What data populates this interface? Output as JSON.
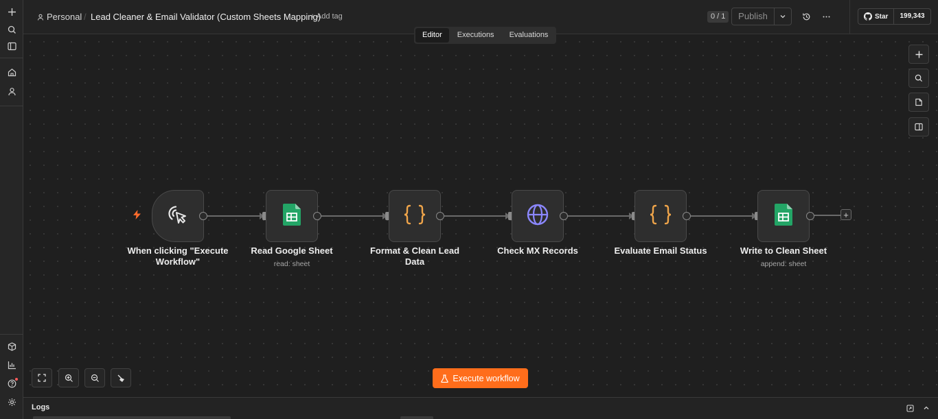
{
  "header": {
    "project": "Personal",
    "title": "Lead Cleaner & Email Validator (Custom Sheets Mapping)",
    "add_tag": "+ Add tag",
    "version_count": "0 / 1",
    "publish_label": "Publish",
    "github_star": "Star",
    "github_count": "199,343"
  },
  "tabs": [
    "Editor",
    "Executions",
    "Evaluations"
  ],
  "active_tab": "Editor",
  "nodes": [
    {
      "label": "When clicking \"Execute Workflow\"",
      "subtitle": "",
      "icon": "cursor-click-icon"
    },
    {
      "label": "Read Google Sheet",
      "subtitle": "read: sheet",
      "icon": "google-sheets-icon"
    },
    {
      "label": "Format & Clean Lead Data",
      "subtitle": "",
      "icon": "code-braces-icon"
    },
    {
      "label": "Check MX Records",
      "subtitle": "",
      "icon": "globe-icon"
    },
    {
      "label": "Evaluate Email Status",
      "subtitle": "",
      "icon": "code-braces-icon"
    },
    {
      "label": "Write to Clean Sheet",
      "subtitle": "append: sheet",
      "icon": "google-sheets-icon"
    }
  ],
  "execute_button": "Execute workflow",
  "logs_label": "Logs",
  "colors": {
    "accent": "#ff6d1b",
    "sheets_green": "#23a566",
    "braces_orange": "#f0a54a",
    "globe_purple": "#8b87ff",
    "canvas_bg": "#1f1f1f"
  }
}
